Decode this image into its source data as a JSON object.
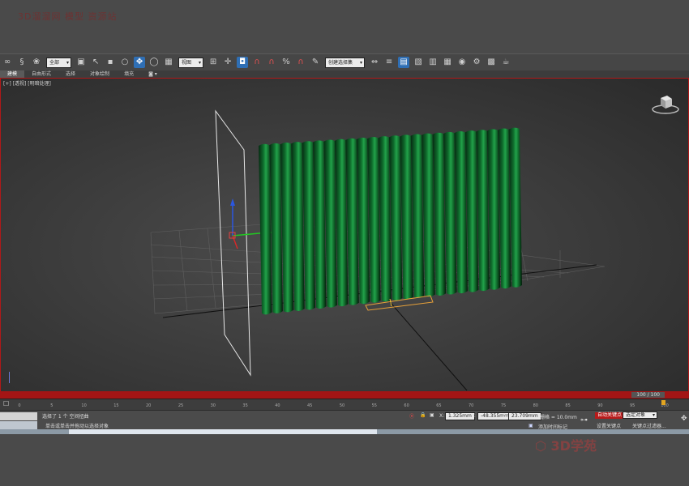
{
  "watermark": {
    "top_text": "3D溜溜网 模型 资源站",
    "logo_text": "3D学苑"
  },
  "toolbar": {
    "selection_filter": "全部",
    "view_dropdown": "视图",
    "named_selection": "创建选择集"
  },
  "ribbon": {
    "tabs": [
      "建模",
      "自由形式",
      "选择",
      "对象绘制",
      "填充"
    ],
    "active": 0
  },
  "viewport": {
    "label": "[+] [透视] [明暗处理]"
  },
  "timeline": {
    "frame_counter": "100 / 100",
    "ticks": [
      "0",
      "5",
      "10",
      "15",
      "20",
      "25",
      "30",
      "35",
      "40",
      "45",
      "50",
      "55",
      "60",
      "65",
      "70",
      "75",
      "80",
      "85",
      "90",
      "95",
      "100"
    ]
  },
  "status": {
    "message1": "选择了 1 个 空间扭曲",
    "message2": "单击或单击并拖动以选择对象",
    "x_label": "X:",
    "x_value": "1.325mm",
    "y_label": "Y:",
    "y_value": "-48.355mm",
    "z_label": "Z:",
    "z_value": "23.709mm",
    "grid": "栅格 = 10.0mm",
    "add_time_tag": "添加时间标记",
    "auto_key": "自动关键点",
    "set_key": "设置关键点",
    "selected_dropdown": "选定对象",
    "key_filters": "关键点过滤器..."
  },
  "colors": {
    "curtain": "#0f6b2c",
    "accent": "#b01818",
    "active_tab": "#2f6fb5"
  }
}
